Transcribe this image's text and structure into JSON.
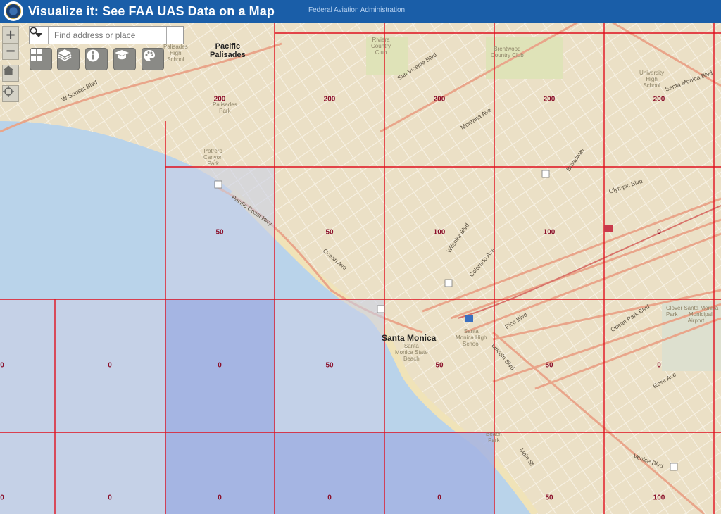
{
  "header": {
    "title": "Visualize it: See FAA UAS Data on a Map",
    "subtitle": "Federal Aviation Administration",
    "logo_icon": "faa-seal-icon",
    "background": "#1a5ea8"
  },
  "controls": {
    "zoom_in_label": "+",
    "zoom_out_label": "−",
    "home_icon": "home-icon",
    "locate_icon": "locate-icon"
  },
  "search": {
    "placeholder": "Find address or place",
    "value": "",
    "dropdown_icon": "chevron-down-icon",
    "search_icon": "search-icon"
  },
  "tools": [
    {
      "name": "basemap-gallery",
      "icon": "grid-icon"
    },
    {
      "name": "layer-list",
      "icon": "layers-icon"
    },
    {
      "name": "about",
      "icon": "info-icon"
    },
    {
      "name": "legend",
      "icon": "graduation-cap-icon"
    },
    {
      "name": "bookmarks",
      "icon": "palette-icon"
    }
  ],
  "grid": {
    "line_color": "#e0101e",
    "label_color": "#8a0f2a",
    "rows": [
      [
        "200",
        "200",
        "200",
        "200",
        "200",
        "200",
        "200"
      ],
      [
        "50",
        "50",
        "100",
        "100",
        "0"
      ],
      [
        "0",
        "0",
        "0",
        "50",
        "50",
        "50",
        "0"
      ],
      [
        "0",
        "0",
        "0",
        "0",
        "0",
        "50",
        "100"
      ]
    ]
  },
  "places": {
    "pacific_palisades": "Pacific\nPalisades",
    "santa_monica": "Santa Monica"
  },
  "pois": {
    "palisades_high": "Palisades\nHigh\nSchool",
    "riviera": "Riviera\nCountry\nClub",
    "brentwood": "Brentwood\nCountry Club",
    "university_high": "University\nHigh\nSchool",
    "palisades_park": "Palisades\nPark",
    "potrero": "Potrero\nCanyon\nPark",
    "sm_high": "Santa\nMonica High\nSchool",
    "sm_beach": "Santa\nMonica State\nBeach",
    "clover_park": "Clover Santa Monica\nPark       Municipal\n              Airport",
    "beach_park": "Beach\nPark"
  },
  "streets": [
    "W Sunset Blvd",
    "Pacific Coast Hwy",
    "San Vicente Blvd",
    "Santa Monica Blvd",
    "Wilshire Blvd",
    "Olympic Blvd",
    "Pico Blvd",
    "Ocean Park Blvd",
    "Lincoln Blvd",
    "Ocean Ave",
    "Montana Ave",
    "Broadway",
    "Colorado Ave",
    "Main St",
    "Rose Ave",
    "Venice Blvd"
  ],
  "colors": {
    "water": "#b9d3ea",
    "land": "#ede4cd",
    "shade_light": "#c9d0e6",
    "shade_dark": "#a3b3e3"
  }
}
